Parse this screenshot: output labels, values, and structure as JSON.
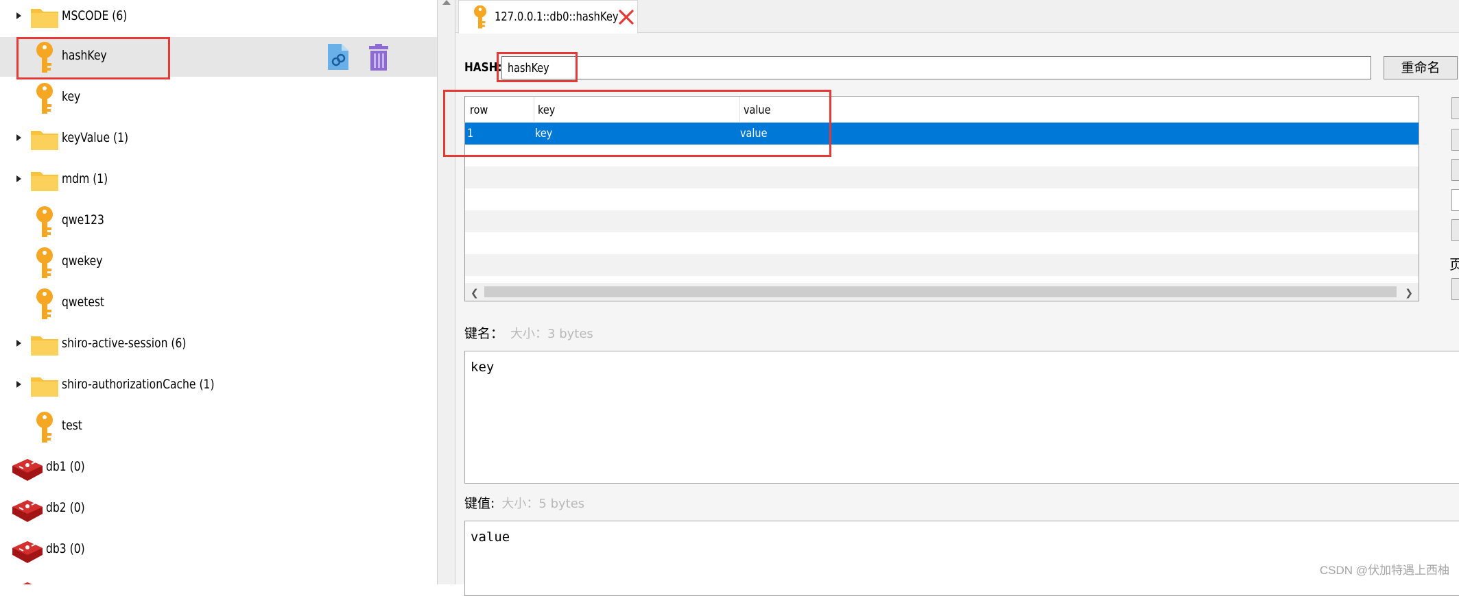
{
  "tree": {
    "items": [
      {
        "label": "MSCODE (6)",
        "type": "folder",
        "expandable": true
      },
      {
        "label": "hashKey",
        "type": "key",
        "selected": true
      },
      {
        "label": "key",
        "type": "key"
      },
      {
        "label": "keyValue (1)",
        "type": "folder",
        "expandable": true
      },
      {
        "label": "mdm (1)",
        "type": "folder",
        "expandable": true
      },
      {
        "label": "qwe123",
        "type": "key"
      },
      {
        "label": "qwekey",
        "type": "key"
      },
      {
        "label": "qwetest",
        "type": "key"
      },
      {
        "label": "shiro-active-session (6)",
        "type": "folder",
        "expandable": true
      },
      {
        "label": "shiro-authorizationCache (1)",
        "type": "folder",
        "expandable": true
      },
      {
        "label": "test",
        "type": "key"
      },
      {
        "label": "db1  (0)",
        "type": "db"
      },
      {
        "label": "db2  (0)",
        "type": "db"
      },
      {
        "label": "db3  (0)",
        "type": "db"
      }
    ],
    "icons": [
      "folder-icon",
      "key-icon",
      "database-icon",
      "copy-link-icon",
      "trash-icon"
    ]
  },
  "tab": {
    "title": "127.0.0.1::db0::hashKey",
    "close_icon": "close-icon"
  },
  "editor": {
    "hash_label": "HASH:",
    "hash_value": "hashKey",
    "rename_label": "重命名",
    "table": {
      "columns": [
        "row",
        "key",
        "value"
      ],
      "rows": [
        {
          "row": "1",
          "key": "key",
          "value": "value"
        }
      ]
    },
    "key_section": {
      "label": "键名：",
      "size": "大小：3 bytes",
      "content": "key"
    },
    "value_section": {
      "label": "键值:",
      "size": "大小：5 bytes",
      "content": "value"
    },
    "side_fragment": "页"
  },
  "watermark": "CSDN @伏加特遇上西柚",
  "colors": {
    "selection": "#0078d7",
    "highlight_box": "#e53935",
    "folder": "#f8c33a",
    "key": "#f5a623",
    "db": "#d32f2f"
  }
}
